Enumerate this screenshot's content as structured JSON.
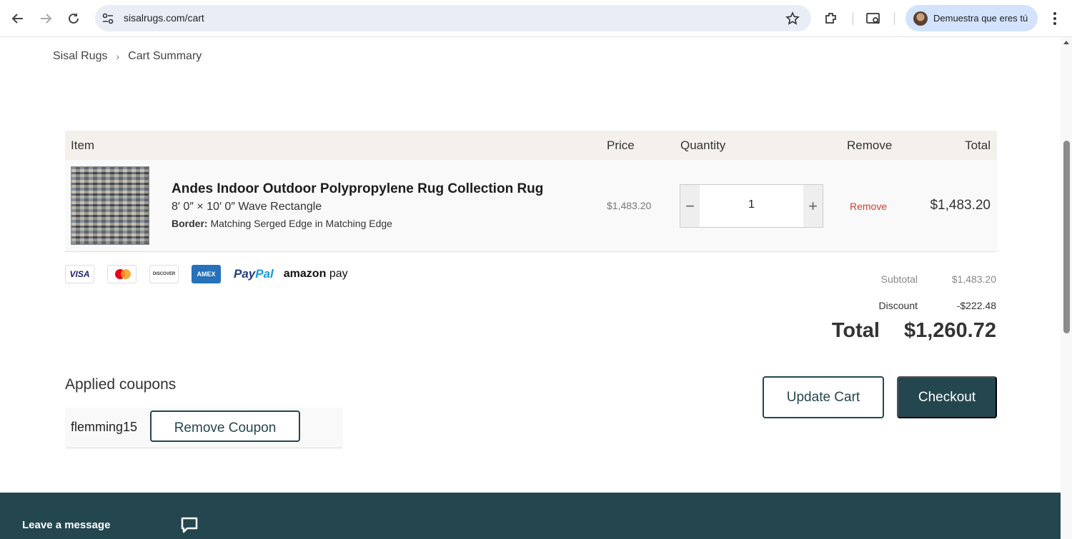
{
  "browser": {
    "url": "sisalrugs.com/cart",
    "profile_label": "Demuestra que eres tú"
  },
  "breadcrumb": {
    "home": "Sisal Rugs",
    "current": "Cart Summary"
  },
  "cart": {
    "headers": {
      "item": "Item",
      "price": "Price",
      "quantity": "Quantity",
      "remove": "Remove",
      "total": "Total"
    },
    "items": [
      {
        "name": "Andes Indoor Outdoor Polypropylene Rug Collection Rug",
        "size": "8′ 0″ × 10′ 0″ Wave Rectangle",
        "border_label": "Border:",
        "border_value": "Matching Serged Edge in Matching Edge",
        "price": "$1,483.20",
        "quantity": "1",
        "remove_label": "Remove",
        "total": "$1,483.20"
      }
    ]
  },
  "payments": {
    "visa": "VISA",
    "discover": "DISCOVER",
    "amex": "AMEX",
    "paypal_pay": "Pay",
    "paypal_pal": "Pal",
    "amazon_brand": "amazon",
    "amazon_pay": "pay"
  },
  "summary": {
    "subtotal_label": "Subtotal",
    "subtotal_value": "$1,483.20",
    "discount_label": "Discount",
    "discount_value": "-$222.48",
    "total_label": "Total",
    "total_value": "$1,260.72"
  },
  "coupons": {
    "title": "Applied coupons",
    "code": "flemming15",
    "remove_label": "Remove Coupon"
  },
  "actions": {
    "update_label": "Update Cart",
    "checkout_label": "Checkout"
  },
  "footer": {
    "leave_message": "Leave a message"
  },
  "colors": {
    "brand_dark": "#24464f",
    "remove_red": "#d23f31"
  }
}
